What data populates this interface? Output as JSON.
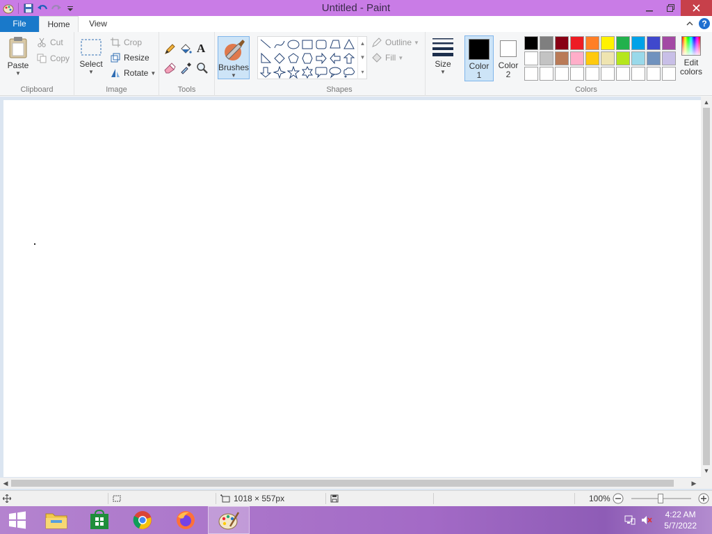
{
  "window": {
    "title": "Untitled - Paint"
  },
  "tabs": {
    "file": "File",
    "home": "Home",
    "view": "View"
  },
  "help_label": "?",
  "clipboard": {
    "paste": "Paste",
    "cut": "Cut",
    "copy": "Copy",
    "group": "Clipboard"
  },
  "image": {
    "select": "Select",
    "crop": "Crop",
    "resize": "Resize",
    "rotate": "Rotate",
    "group": "Image"
  },
  "tools": {
    "group": "Tools",
    "text_tool": "A"
  },
  "brushes": {
    "label": "Brushes"
  },
  "shapes": {
    "group": "Shapes",
    "outline": "Outline",
    "fill": "Fill",
    "items": [
      "line",
      "curve",
      "oval",
      "rectangle",
      "rounded-rectangle",
      "polygon",
      "triangle",
      "right-triangle",
      "diamond",
      "pentagon",
      "hexagon",
      "right-arrow",
      "left-arrow",
      "up-arrow",
      "down-arrow",
      "four-point-star",
      "five-point-star",
      "six-point-star",
      "rounded-callout",
      "oval-callout",
      "cloud-callout"
    ]
  },
  "size": {
    "label": "Size"
  },
  "colors": {
    "group": "Colors",
    "color1_line1": "Color",
    "color1_line2": "1",
    "color2_line1": "Color",
    "color2_line2": "2",
    "edit_line1": "Edit",
    "edit_line2": "colors",
    "color1": "#000000",
    "color2": "#ffffff",
    "palette_row1": [
      "#000000",
      "#7f7f7f",
      "#880015",
      "#ed1c24",
      "#ff7f27",
      "#fff200",
      "#22b14c",
      "#00a2e8",
      "#3f48cc",
      "#a349a4"
    ],
    "palette_row2": [
      "#ffffff",
      "#c3c3c3",
      "#b97a57",
      "#ffaec9",
      "#ffc90e",
      "#efe4b0",
      "#b5e61d",
      "#99d9ea",
      "#7092be",
      "#c8bfe7"
    ],
    "palette_row3": [
      "#ffffff",
      "#ffffff",
      "#ffffff",
      "#ffffff",
      "#ffffff",
      "#ffffff",
      "#ffffff",
      "#ffffff",
      "#ffffff",
      "#ffffff"
    ]
  },
  "status": {
    "canvas_size": "1018 × 557px",
    "zoom": "100%"
  },
  "taskbar": {
    "time": "4:22 AM",
    "date": "5/7/2022"
  },
  "accent": "#1979ca",
  "titlebar_color": "#c97ce6"
}
